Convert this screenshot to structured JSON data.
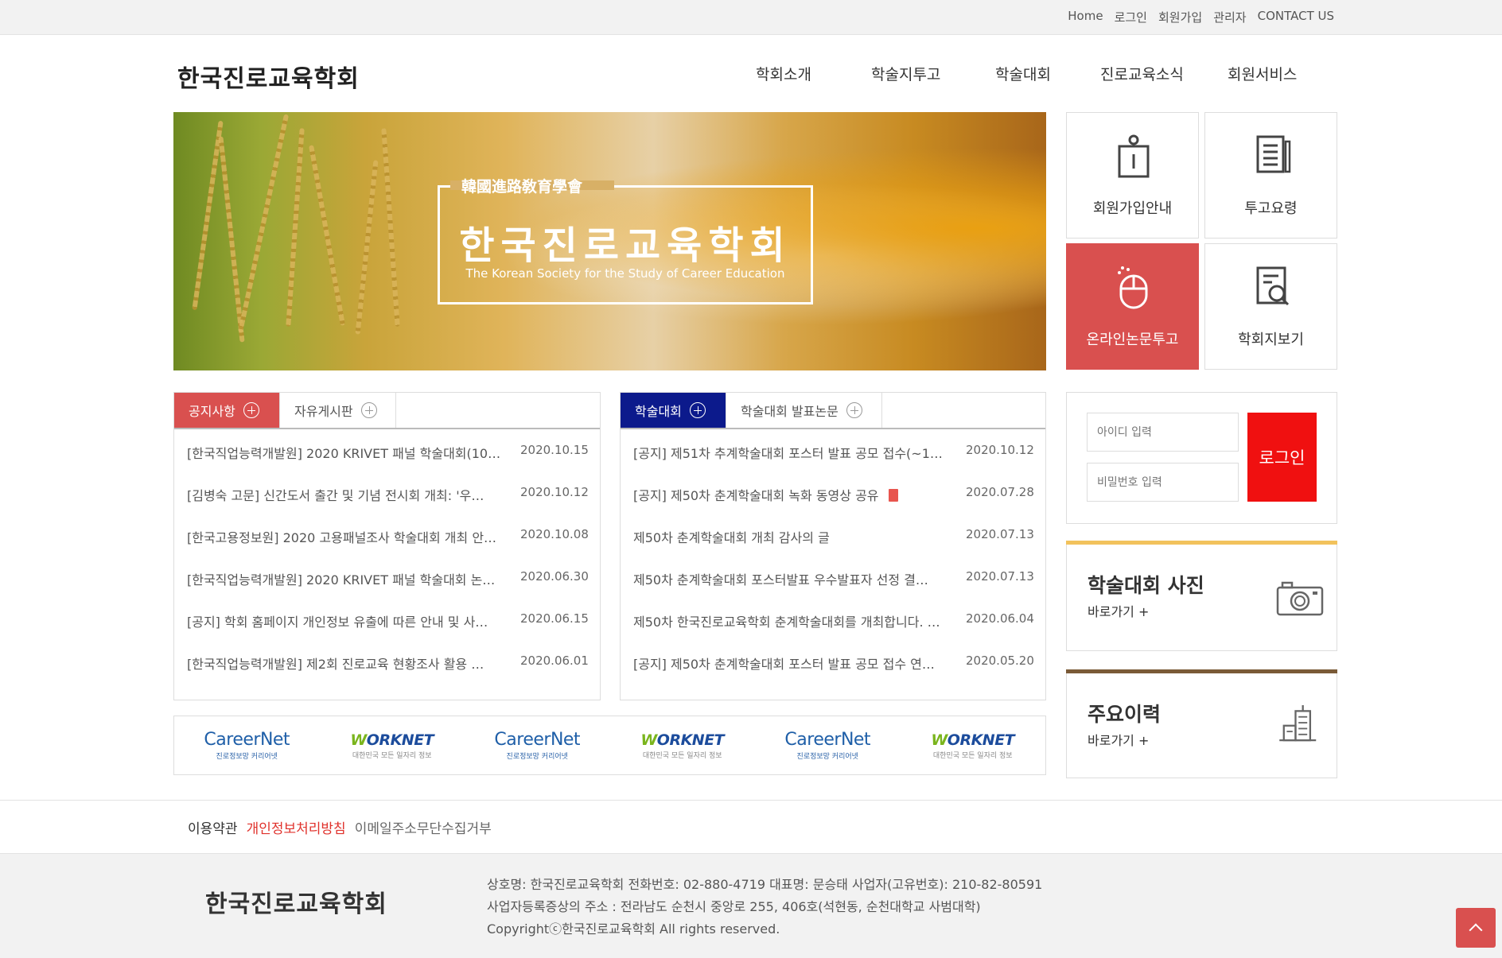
{
  "util_nav": [
    "Home",
    "로그인",
    "회원가입",
    "관리자",
    "CONTACT US"
  ],
  "logo": "한국진로교육학회",
  "gnb": [
    "학회소개",
    "학술지투고",
    "학술대회",
    "진로교육소식",
    "회원서비스"
  ],
  "banner": {
    "hanja": "韓國進路敎育學會",
    "title": "한국진로교육학회",
    "subtitle": "The Korean Society for the Study of Career Education"
  },
  "tiles": [
    {
      "label": "회원가입안내",
      "icon": "person-info-icon"
    },
    {
      "label": "투고요령",
      "icon": "document-pen-icon"
    },
    {
      "label": "온라인논문투고",
      "icon": "mouse-icon"
    },
    {
      "label": "학회지보기",
      "icon": "document-search-icon"
    }
  ],
  "board1": {
    "tabs": [
      "공지사항",
      "자유게시판"
    ],
    "active_color": "#d9504f",
    "rows": [
      {
        "title": "[한국직업능력개발원] 2020 KRIVET 패널 학술대회(10…",
        "date": "2020.10.15"
      },
      {
        "title": "[김병숙 고문] 신간도서 출간 및 기념 전시회 개최: '우…",
        "date": "2020.10.12"
      },
      {
        "title": "[한국고용정보원] 2020 고용패널조사 학술대회 개최 안…",
        "date": "2020.10.08"
      },
      {
        "title": "[한국직업능력개발원] 2020 KRIVET 패널 학술대회 논…",
        "date": "2020.06.30"
      },
      {
        "title": "[공지] 학회 홈페이지 개인정보 유출에 따른 안내 및 사…",
        "date": "2020.06.15"
      },
      {
        "title": "[한국직업능력개발원] 제2회 진로교육 현황조사 활용 …",
        "date": "2020.06.01"
      }
    ]
  },
  "board2": {
    "tabs": [
      "학술대회",
      "학술대회 발표논문"
    ],
    "active_color": "#0c1a8c",
    "rows": [
      {
        "title": "[공지] 제51차 추계학술대회 포스터 발표 공모 접수(~1…",
        "date": "2020.10.12"
      },
      {
        "title": "[공지] 제50차 춘계학술대회 녹화 동영상 공유",
        "date": "2020.07.28"
      },
      {
        "title": "제50차 춘계학술대회 개최 감사의 글",
        "date": "2020.07.13"
      },
      {
        "title": "제50차 춘계학술대회 포스터발표 우수발표자 선정 결…",
        "date": "2020.07.13"
      },
      {
        "title": "제50차 한국진로교육학회 춘계학술대회를 개최합니다. …",
        "date": "2020.06.04"
      },
      {
        "title": "[공지] 제50차 춘계학술대회 포스터 발표 공모 접수 연…",
        "date": "2020.05.20"
      }
    ]
  },
  "partners": [
    {
      "name": "CareerNet",
      "sub": "진로정보망 커리어넷"
    },
    {
      "name": "WORKNET",
      "sub": "대한민국 모든 일자리 정보"
    },
    {
      "name": "CareerNet",
      "sub": "진로정보망 커리어넷"
    },
    {
      "name": "WORKNET",
      "sub": "대한민국 모든 일자리 정보"
    },
    {
      "name": "CareerNet",
      "sub": "진로정보망 커리어넷"
    },
    {
      "name": "WORKNET",
      "sub": "대한민국 모든 일자리 정보"
    }
  ],
  "login": {
    "id_placeholder": "아이디 입력",
    "pw_placeholder": "비밀번호 입력",
    "button": "로그인"
  },
  "shortcuts": [
    {
      "title": "학술대회 사진",
      "link": "바로가기 +",
      "bar_color": "#f2c25c",
      "icon": "camera-icon"
    },
    {
      "title": "주요이력",
      "link": "바로가기 +",
      "bar_color": "#7a5a37",
      "icon": "building-icon"
    }
  ],
  "footer_links": [
    {
      "label": "이용약관",
      "color": "#333333"
    },
    {
      "label": "개인정보처리방침",
      "color": "#e0322c"
    },
    {
      "label": "이메일주소무단수집거부",
      "color": "#666666"
    }
  ],
  "footer": {
    "logo": "한국진로교육학회",
    "line1": "상호명: 한국진로교육학회   전화번호: 02-880-4719   대표명: 문승태   사업자(고유번호): 210-82-80591",
    "line2": "사업자등록증상의 주소 : 전라남도 순천시 중앙로 255, 406호(석현동, 순천대학교 사범대학)",
    "line3": "Copyrightⓒ한국진로교육학회 All rights reserved."
  }
}
